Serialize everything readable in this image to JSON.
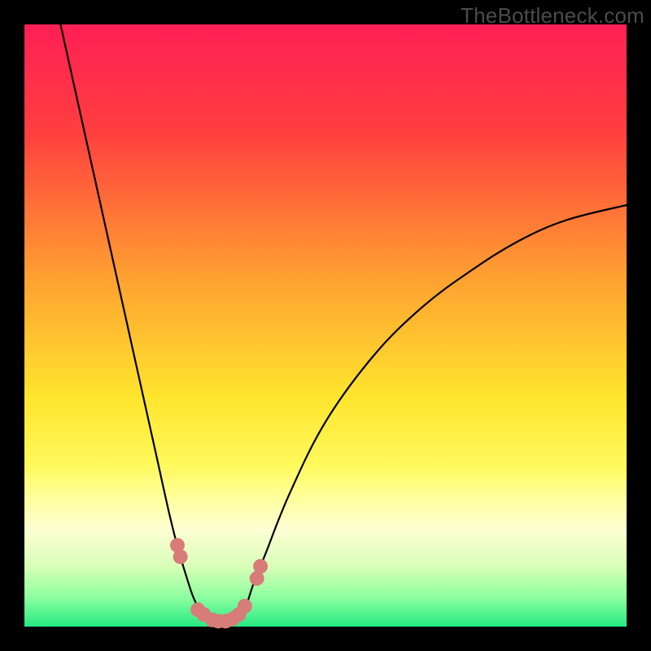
{
  "watermark": "TheBottleneck.com",
  "chart_data": {
    "type": "line",
    "title": "",
    "xlabel": "",
    "ylabel": "",
    "xlim": [
      0,
      100
    ],
    "ylim": [
      0,
      100
    ],
    "background_gradient_stops": [
      {
        "pos": 0.0,
        "color": "#ff1f55"
      },
      {
        "pos": 0.18,
        "color": "#ff3f3f"
      },
      {
        "pos": 0.42,
        "color": "#ffa031"
      },
      {
        "pos": 0.62,
        "color": "#ffe52e"
      },
      {
        "pos": 0.73,
        "color": "#fff95b"
      },
      {
        "pos": 0.79,
        "color": "#ffffa0"
      },
      {
        "pos": 0.84,
        "color": "#fdffd4"
      },
      {
        "pos": 0.9,
        "color": "#d8ffb8"
      },
      {
        "pos": 0.95,
        "color": "#8fffa0"
      },
      {
        "pos": 1.0,
        "color": "#26ea82"
      }
    ],
    "series": [
      {
        "name": "bottleneck-curve",
        "x": [
          6,
          8,
          10,
          12,
          14,
          16,
          18,
          20,
          22,
          24,
          25.5,
          27,
          28,
          29,
          30,
          31,
          32,
          33,
          34,
          35,
          36,
          37,
          38,
          40,
          44,
          50,
          58,
          66,
          74,
          82,
          90,
          100
        ],
        "y": [
          100,
          91,
          82,
          73,
          64,
          55,
          46,
          37,
          28,
          19,
          13,
          8,
          5,
          3,
          1.8,
          1.1,
          0.7,
          0.6,
          0.7,
          1.2,
          2.2,
          4,
          7,
          12,
          22,
          34,
          45,
          53,
          59,
          64,
          67.5,
          70
        ]
      }
    ],
    "markers": {
      "name": "highlighted-points",
      "points": [
        {
          "x": 25.4,
          "y": 13.5
        },
        {
          "x": 25.9,
          "y": 11.6
        },
        {
          "x": 28.8,
          "y": 2.8
        },
        {
          "x": 29.8,
          "y": 2.0
        },
        {
          "x": 31.2,
          "y": 1.1
        },
        {
          "x": 32.2,
          "y": 0.9
        },
        {
          "x": 33.4,
          "y": 0.9
        },
        {
          "x": 34.6,
          "y": 1.3
        },
        {
          "x": 35.6,
          "y": 2.0
        },
        {
          "x": 36.6,
          "y": 3.4
        },
        {
          "x": 38.6,
          "y": 8.0
        },
        {
          "x": 39.2,
          "y": 10.0
        }
      ],
      "radius": 9
    }
  }
}
